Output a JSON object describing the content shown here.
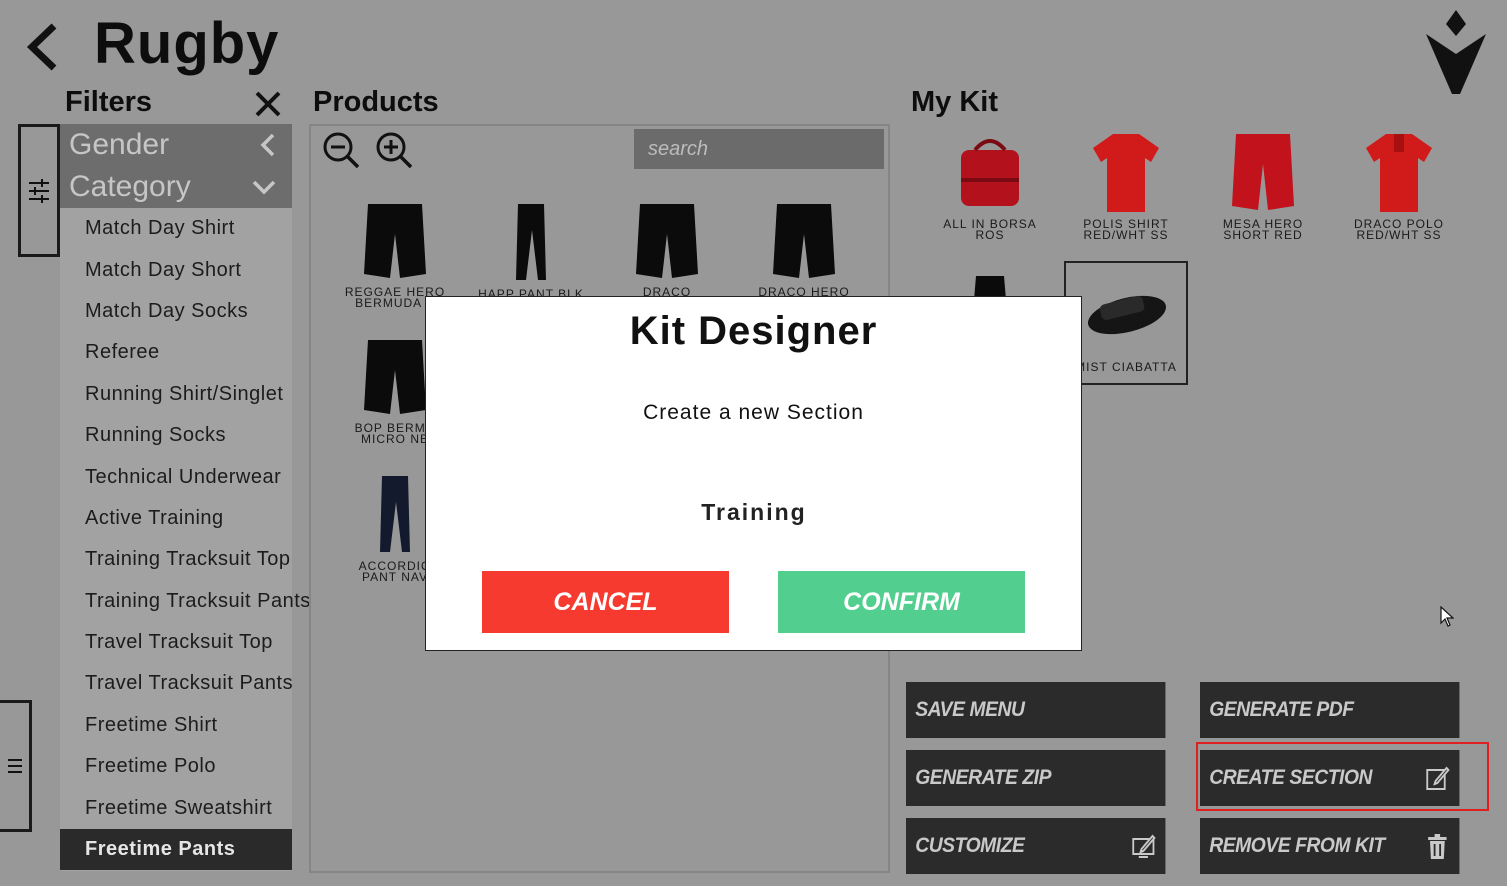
{
  "header": {
    "title": "Rugby",
    "back_icon": "chevron-left-icon",
    "logo": "brand-logo"
  },
  "filters": {
    "title": "Filters",
    "gender_label": "Gender",
    "category_label": "Category",
    "items": [
      {
        "label": "Match Day Shirt"
      },
      {
        "label": "Match Day Short"
      },
      {
        "label": "Match Day Socks"
      },
      {
        "label": "Referee"
      },
      {
        "label": "Running Shirt/Singlet"
      },
      {
        "label": "Running Socks"
      },
      {
        "label": "Technical Underwear"
      },
      {
        "label": "Active Training"
      },
      {
        "label": "Training Tracksuit Top"
      },
      {
        "label": "Training Tracksuit Pants"
      },
      {
        "label": "Travel Tracksuit Top"
      },
      {
        "label": "Travel Tracksuit Pants"
      },
      {
        "label": "Freetime Shirt"
      },
      {
        "label": "Freetime Polo"
      },
      {
        "label": "Freetime Sweatshirt"
      },
      {
        "label": "Freetime Pants"
      }
    ],
    "selected": "Freetime Pants"
  },
  "products": {
    "title": "Products",
    "search_placeholder": "search",
    "items": [
      {
        "line1": "REGGAE HERO",
        "line2": "BERMUDA B"
      },
      {
        "line1": "HAPP PANT BLK",
        "line2": ""
      },
      {
        "line1": "DRACO",
        "line2": ""
      },
      {
        "line1": "DRACO HERO",
        "line2": ""
      },
      {
        "line1": "BOP BERMU",
        "line2": "MICRO NE"
      },
      {
        "line1": "ACCORDIO",
        "line2": "PANT NAV"
      }
    ]
  },
  "kit": {
    "title": "My Kit",
    "items": [
      {
        "line1": "ALL IN BORSA",
        "line2": "ROS"
      },
      {
        "line1": "POLIS SHIRT",
        "line2": "RED/WHT SS"
      },
      {
        "line1": "MESA HERO",
        "line2": "SHORT RED"
      },
      {
        "line1": "DRACO POLO",
        "line2": "RED/WHT SS"
      },
      {
        "line1": "MIST CIABATTA",
        "line2": ""
      }
    ]
  },
  "actions": {
    "save_menu": "SAVE MENU",
    "generate_pdf": "GENERATE PDF",
    "generate_zip": "GENERATE ZIP",
    "create_section": "CREATE SECTION",
    "customize": "CUSTOMIZE",
    "remove_from_kit": "REMOVE FROM KIT"
  },
  "modal": {
    "title": "Kit Designer",
    "prompt": "Create a new Section",
    "input_value": "Training",
    "cancel_label": "CANCEL",
    "confirm_label": "CONFIRM"
  },
  "colors": {
    "background": "#989898",
    "cancel": "#f63a2f",
    "confirm": "#52cf8e",
    "highlight": "#e02020",
    "dark_button": "#2b2b2b"
  }
}
